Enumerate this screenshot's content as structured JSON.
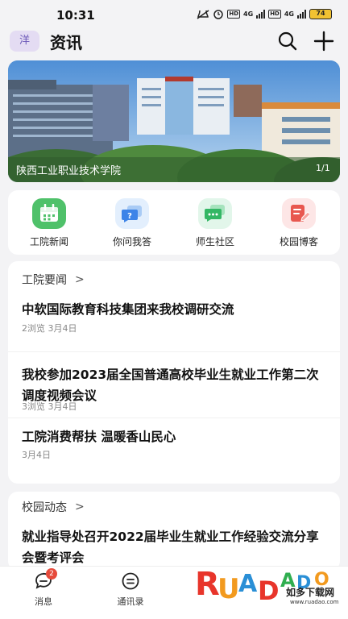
{
  "status_bar": {
    "time": "10:31",
    "network": "4G",
    "hd": "HD",
    "battery": "74"
  },
  "header": {
    "avatar_text": "洋",
    "title": "资讯"
  },
  "banner": {
    "caption": "陕西工业职业技术学院",
    "index": "1/1"
  },
  "quick_nav": [
    {
      "label": "工院新闻",
      "icon": "calendar-icon",
      "bg": "#4fc16a"
    },
    {
      "label": "你问我答",
      "icon": "question-chat-icon",
      "bg": "#e3effd"
    },
    {
      "label": "师生社区",
      "icon": "community-chat-icon",
      "bg": "#e2f6ea"
    },
    {
      "label": "校园博客",
      "icon": "blog-edit-icon",
      "bg": "#fde6e6"
    }
  ],
  "sections": [
    {
      "title": "工院要闻",
      "items": [
        {
          "title": "中软国际教育科技集团来我校调研交流",
          "meta": "2浏览  3月4日"
        },
        {
          "title": "我校参加2023届全国普通高校毕业生就业工作第二次调度视频会议",
          "meta": "3浏览  3月4日"
        },
        {
          "title": "工院消费帮扶 温暖香山民心",
          "meta": "3月4日"
        }
      ]
    },
    {
      "title": "校园动态",
      "items": [
        {
          "title": "就业指导处召开2022届毕业生就业工作经验交流分享会暨考评会",
          "meta": ""
        }
      ]
    }
  ],
  "tab_bar": [
    {
      "label": "消息",
      "icon": "message-icon",
      "badge": "2"
    },
    {
      "label": "通讯录",
      "icon": "contacts-icon"
    }
  ],
  "watermark": {
    "logo": "RUANDAO",
    "sub": "如多下载网",
    "url": "www.ruadao.com"
  },
  "colors": {
    "accent": "#6b57b8",
    "badge": "#e64a3b",
    "green": "#4fc16a",
    "blue": "#3d84e8",
    "red": "#e8574f"
  }
}
